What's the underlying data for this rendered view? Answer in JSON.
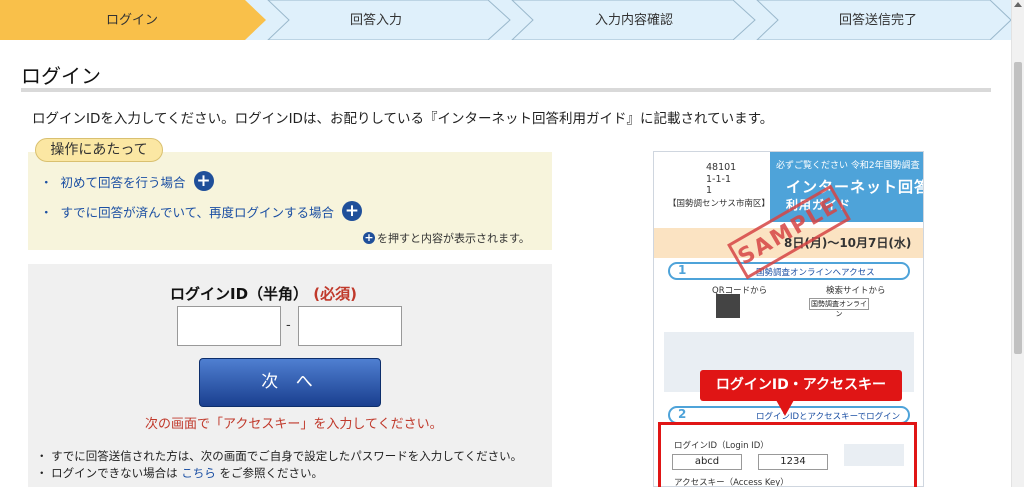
{
  "steps": [
    {
      "label": "ログイン",
      "active": true
    },
    {
      "label": "回答入力",
      "active": false
    },
    {
      "label": "入力内容確認",
      "active": false
    },
    {
      "label": "回答送信完了",
      "active": false
    }
  ],
  "colors": {
    "active_step": "#f9c04a",
    "inactive_step": "#dff0fb",
    "link": "#1b4fa3",
    "required": "#c0392b",
    "button": "#1a3f8f"
  },
  "page_title": "ログイン",
  "instruction": "ログインIDを入力してください。ログインIDは、お配りしている『インターネット回答利用ガイド』に記載されています。",
  "ops": {
    "tab": "操作にあたって",
    "items": [
      {
        "bullet": "・",
        "text": "初めて回答を行う場合",
        "icon": "plus-icon"
      },
      {
        "bullet": "・",
        "text": "すでに回答が済んでいて、再度ログインする場合",
        "icon": "plus-icon"
      }
    ],
    "note": "を押すと内容が表示されます。"
  },
  "login": {
    "label": "ログインID（半角）",
    "required": "(必須)",
    "id_part1": "",
    "id_part2": "",
    "separator": "-",
    "next_button": "次 へ",
    "next_note": "次の画面で「アクセスキー」を入力してください。",
    "note1": "・ すでに回答送信された方は、次の画面でご自身で設定したパスワードを入力してください。",
    "note2_pre": "・ ログインできない場合は",
    "note2_link": "こちら",
    "note2_post": "をご参照ください。"
  },
  "guide": {
    "num1": "48101",
    "num2": "1-1-1",
    "num3": "1",
    "district": "【国勢調センサス市南区】",
    "top_line": "必ずご覧ください 令和2年国勢調査",
    "title": "インターネット回答",
    "subtitle": "利用ガイド",
    "date": "8日(月)～10月7日(水)",
    "section1": "1",
    "section1_text": "国勢調査オンラインへアクセス",
    "section2": "2",
    "section2_text": "ログインIDとアクセスキーでログイン",
    "qr_label": "QRコードから",
    "search_label": "検索サイトから",
    "search_box": "国勢調査オンライン",
    "login_id_caption": "ログインID（Login ID）",
    "login_id_value1": "abcd",
    "login_id_value2": "1234",
    "access_key_caption": "アクセスキー（Access Key）",
    "stamp": "SAMPLE",
    "callout": "ログインID・アクセスキー"
  }
}
